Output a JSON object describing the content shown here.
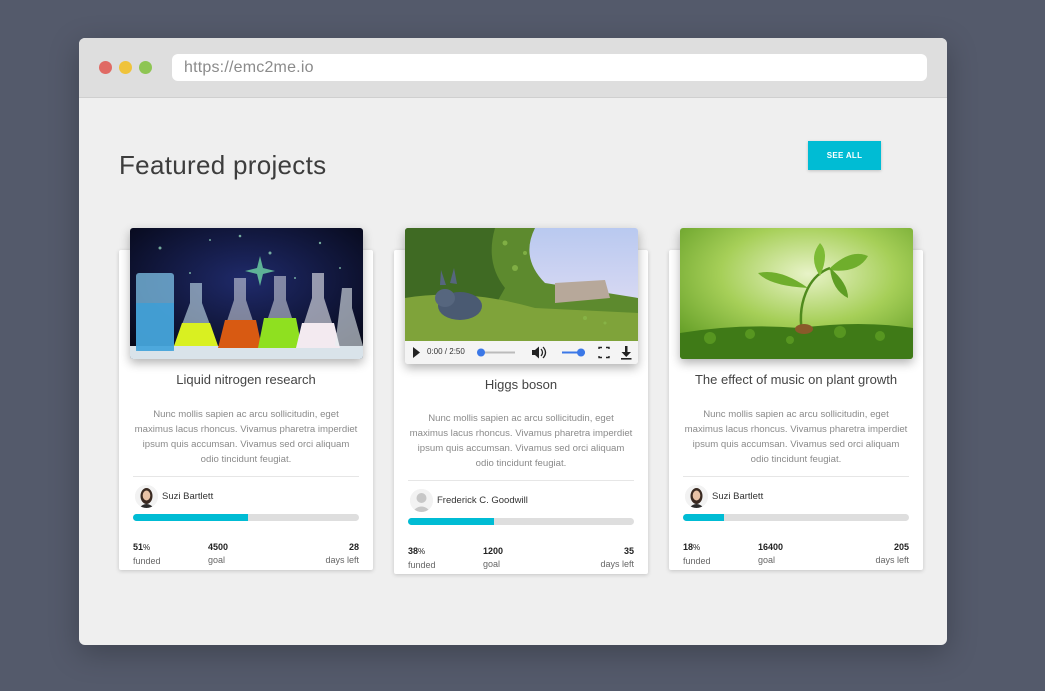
{
  "browser": {
    "url": "https://emc2me.io"
  },
  "page": {
    "title": "Featured projects",
    "see_all_label": "SEE ALL"
  },
  "colors": {
    "accent": "#00bcd4",
    "background": "#545a6b",
    "window": "#efefef"
  },
  "cards": [
    {
      "title": "Liquid nitrogen research",
      "description": "Nunc mollis sapien ac arcu sollicitudin, eget maximus lacus rhoncus. Vivamus pharetra imperdiet ipsum quis accumsan. Vivamus sed orci aliquam odio tincidunt feugiat.",
      "author": "Suzi Bartlett",
      "funded_pct": "51",
      "funded_fraction": 0.51,
      "pct_symbol": "%",
      "funded_label": "funded",
      "goal": "4500",
      "goal_label": "goal",
      "days_left": "28",
      "days_label": "days left"
    },
    {
      "title": "Higgs boson",
      "description": "Nunc mollis sapien ac arcu sollicitudin, eget maximus lacus rhoncus. Vivamus pharetra imperdiet ipsum quis accumsan. Vivamus sed orci aliquam odio tincidunt feugiat.",
      "author": "Frederick C. Goodwill",
      "funded_pct": "38",
      "funded_fraction": 0.38,
      "pct_symbol": "%",
      "funded_label": "funded",
      "goal": "1200",
      "goal_label": "goal",
      "days_left": "35",
      "days_label": "days left",
      "video": {
        "time": "0:00 / 2:50",
        "progress": 0.0,
        "volume": 0.85
      }
    },
    {
      "title": "The effect of music on plant growth",
      "description": "Nunc mollis sapien ac arcu sollicitudin, eget maximus lacus rhoncus. Vivamus pharetra imperdiet ipsum quis accumsan. Vivamus sed orci aliquam odio tincidunt feugiat.",
      "author": "Suzi Bartlett",
      "funded_pct": "18",
      "funded_fraction": 0.18,
      "pct_symbol": "%",
      "funded_label": "funded",
      "goal": "16400",
      "goal_label": "goal",
      "days_left": "205",
      "days_label": "days left"
    }
  ]
}
